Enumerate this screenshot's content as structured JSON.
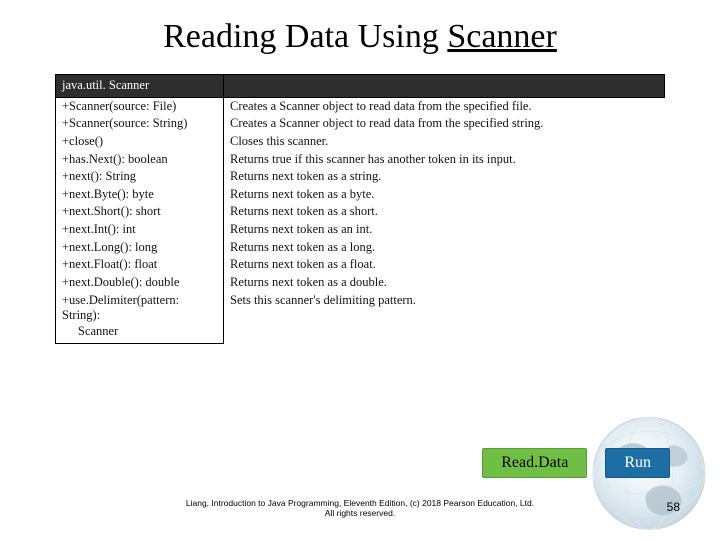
{
  "title_part1": "Reading Data Using ",
  "title_part2": "Scanner",
  "class_header": "java.util. Scanner",
  "methods": [
    {
      "sig": "+Scanner(source: File)",
      "desc": "Creates a Scanner object to read data from the specified file."
    },
    {
      "sig": "+Scanner(source: String)",
      "desc": "Creates a Scanner object to read data from the specified string."
    },
    {
      "sig": "+close()",
      "desc": "Closes this scanner."
    },
    {
      "sig": "+has.Next(): boolean",
      "desc": "Returns true if this scanner has another token in its input."
    },
    {
      "sig": "+next(): String",
      "desc": "Returns next token as a string."
    },
    {
      "sig": "+next.Byte(): byte",
      "desc": "Returns next token as a byte."
    },
    {
      "sig": "+next.Short(): short",
      "desc": "Returns next token as a short."
    },
    {
      "sig": "+next.Int(): int",
      "desc": "Returns next token as an int."
    },
    {
      "sig": "+next.Long(): long",
      "desc": "Returns next token as a long."
    },
    {
      "sig": "+next.Float(): float",
      "desc": "Returns next token as a float."
    },
    {
      "sig": "+next.Double(): double",
      "desc": "Returns next token as a double."
    },
    {
      "sig": "+use.Delimiter(pattern: String):",
      "sig2": "Scanner",
      "desc": "Sets this scanner's delimiting pattern."
    }
  ],
  "buttons": {
    "readdata": "Read.Data",
    "run": "Run"
  },
  "footer_line1": "Liang, Introduction to Java Programming, Eleventh Edition, (c) 2018 Pearson Education, Ltd.",
  "footer_line2": "All rights reserved.",
  "page_number": "58"
}
